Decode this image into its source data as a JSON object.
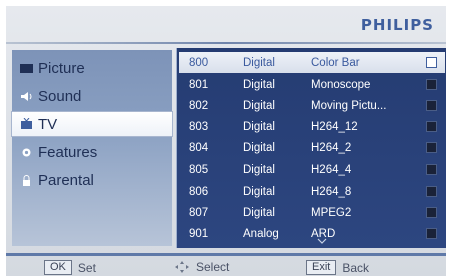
{
  "brand": "PHILIPS",
  "menu": [
    {
      "label": "Picture",
      "icon": "picture-icon"
    },
    {
      "label": "Sound",
      "icon": "speaker-icon"
    },
    {
      "label": "TV",
      "icon": "tv-icon"
    },
    {
      "label": "Features",
      "icon": "gear-icon"
    },
    {
      "label": "Parental",
      "icon": "lock-icon"
    }
  ],
  "selected_menu": "TV",
  "channels": [
    {
      "num": "800",
      "type": "Digital",
      "name": "Color Bar"
    },
    {
      "num": "801",
      "type": "Digital",
      "name": "Monoscope"
    },
    {
      "num": "802",
      "type": "Digital",
      "name": "Moving Pictu..."
    },
    {
      "num": "803",
      "type": "Digital",
      "name": "H264_12"
    },
    {
      "num": "804",
      "type": "Digital",
      "name": "H264_2"
    },
    {
      "num": "805",
      "type": "Digital",
      "name": "H264_4"
    },
    {
      "num": "806",
      "type": "Digital",
      "name": "H264_8"
    },
    {
      "num": "807",
      "type": "Digital",
      "name": "MPEG2"
    },
    {
      "num": "901",
      "type": "Analog",
      "name": "ARD"
    }
  ],
  "footer": {
    "ok_key": "OK",
    "ok_label": "Set",
    "select_label": "Select",
    "exit_key": "Exit",
    "exit_label": "Back"
  },
  "colors": {
    "panel": "#253c72",
    "brand": "#3f5f9e",
    "highlight": "#eef2f8"
  }
}
